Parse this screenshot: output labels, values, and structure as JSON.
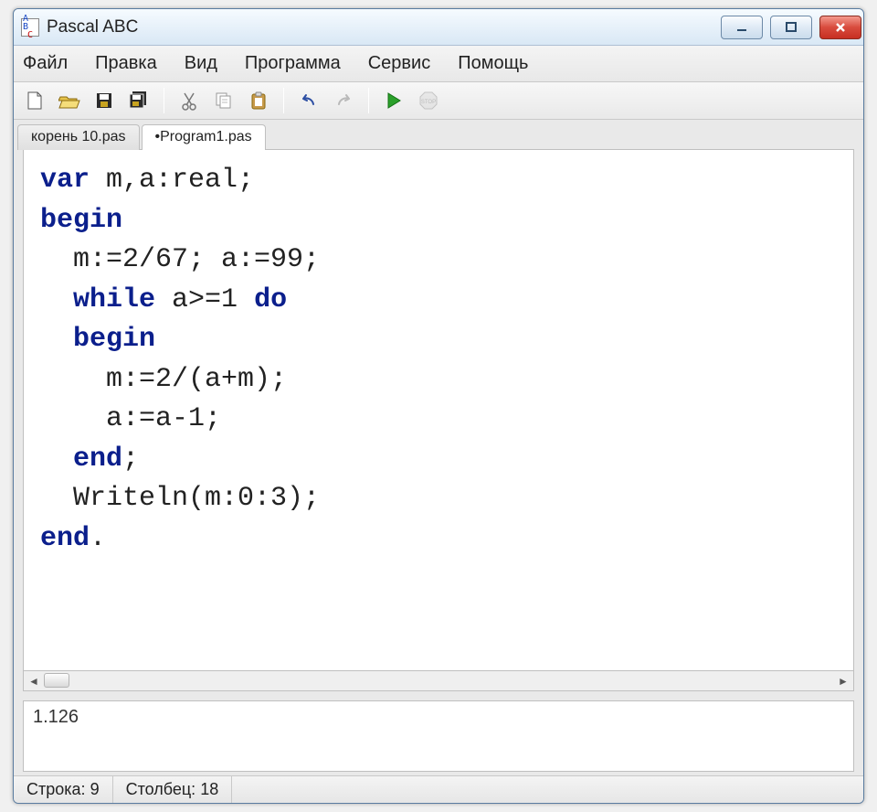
{
  "title": "Pascal ABC",
  "menu": {
    "file": "Файл",
    "edit": "Правка",
    "view": "Вид",
    "program": "Программа",
    "service": "Сервис",
    "help": "Помощь"
  },
  "tabs": {
    "t0": "корень 10.pas",
    "t1": "•Program1.pas"
  },
  "code": {
    "l1a": "var",
    "l1b": " m,a:real;",
    "l2": "begin",
    "l3": "  m:=2/67; a:=99;",
    "l4a": "  ",
    "l4b": "while",
    "l4c": " a>=1 ",
    "l4d": "do",
    "l5a": "  ",
    "l5b": "begin",
    "l6": "    m:=2/(a+m);",
    "l7": "    a:=a-1;",
    "l8a": "  ",
    "l8b": "end",
    "l8c": ";",
    "l9": "  Writeln(m:0:3);",
    "l10a": "end",
    "l10b": "."
  },
  "output": "1.126",
  "status": {
    "row_label": "Строка:",
    "row_value": "9",
    "col_label": "Столбец:",
    "col_value": "18"
  }
}
